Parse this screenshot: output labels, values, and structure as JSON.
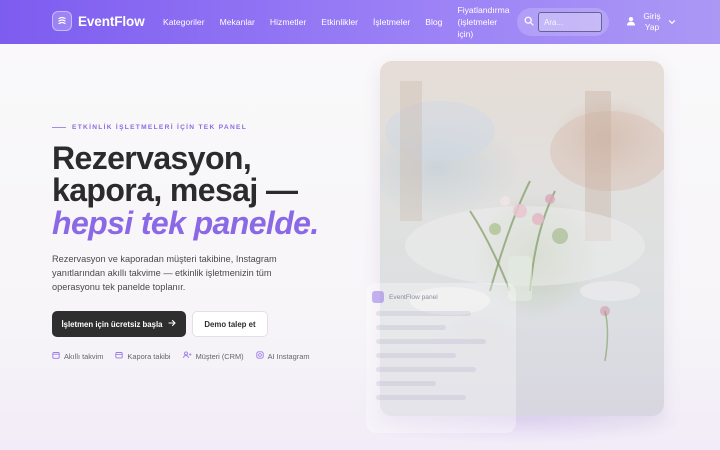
{
  "brand": {
    "name": "EventFlow"
  },
  "nav": {
    "items": [
      {
        "label": "Kategoriler"
      },
      {
        "label": "Mekanlar"
      },
      {
        "label": "Hizmetler"
      },
      {
        "label": "Etkinlikler"
      },
      {
        "label": "İşletmeler"
      },
      {
        "label": "Blog"
      }
    ],
    "pricing_label": "Fiyatlandırma (işletmeler için)"
  },
  "search": {
    "placeholder": "Ara..."
  },
  "login": {
    "label": "Giriş Yap"
  },
  "hero": {
    "eyebrow": "ETKİNLİK İŞLETMELERİ İÇİN TEK PANEL",
    "headline_line1": "Rezervasyon,",
    "headline_line2": "kapora, mesaj —",
    "headline_accent": "hepsi tek panelde.",
    "description": "Rezervasyon ve kaporadan müşteri takibine, Instagram yanıtlarından akıllı takvime — etkinlik işletmenizin tüm operasyonu tek panelde toplanır.",
    "primary_cta": "İşletmen için ücretsiz başla",
    "secondary_cta": "Demo talep et",
    "features": [
      {
        "label": "Akıllı takvim",
        "icon": "calendar-icon"
      },
      {
        "label": "Kapora takibi",
        "icon": "wallet-icon"
      },
      {
        "label": "Müşteri (CRM)",
        "icon": "users-icon"
      },
      {
        "label": "AI Instagram",
        "icon": "instagram-icon"
      }
    ]
  },
  "preview_panel": {
    "title": "EventFlow panel"
  },
  "colors": {
    "nav_gradient_start": "#7d5cf0",
    "nav_gradient_end": "#ab98f5",
    "accent": "#8b68e5",
    "primary_button": "#2e2e2e",
    "text": "#2b2b2b"
  }
}
